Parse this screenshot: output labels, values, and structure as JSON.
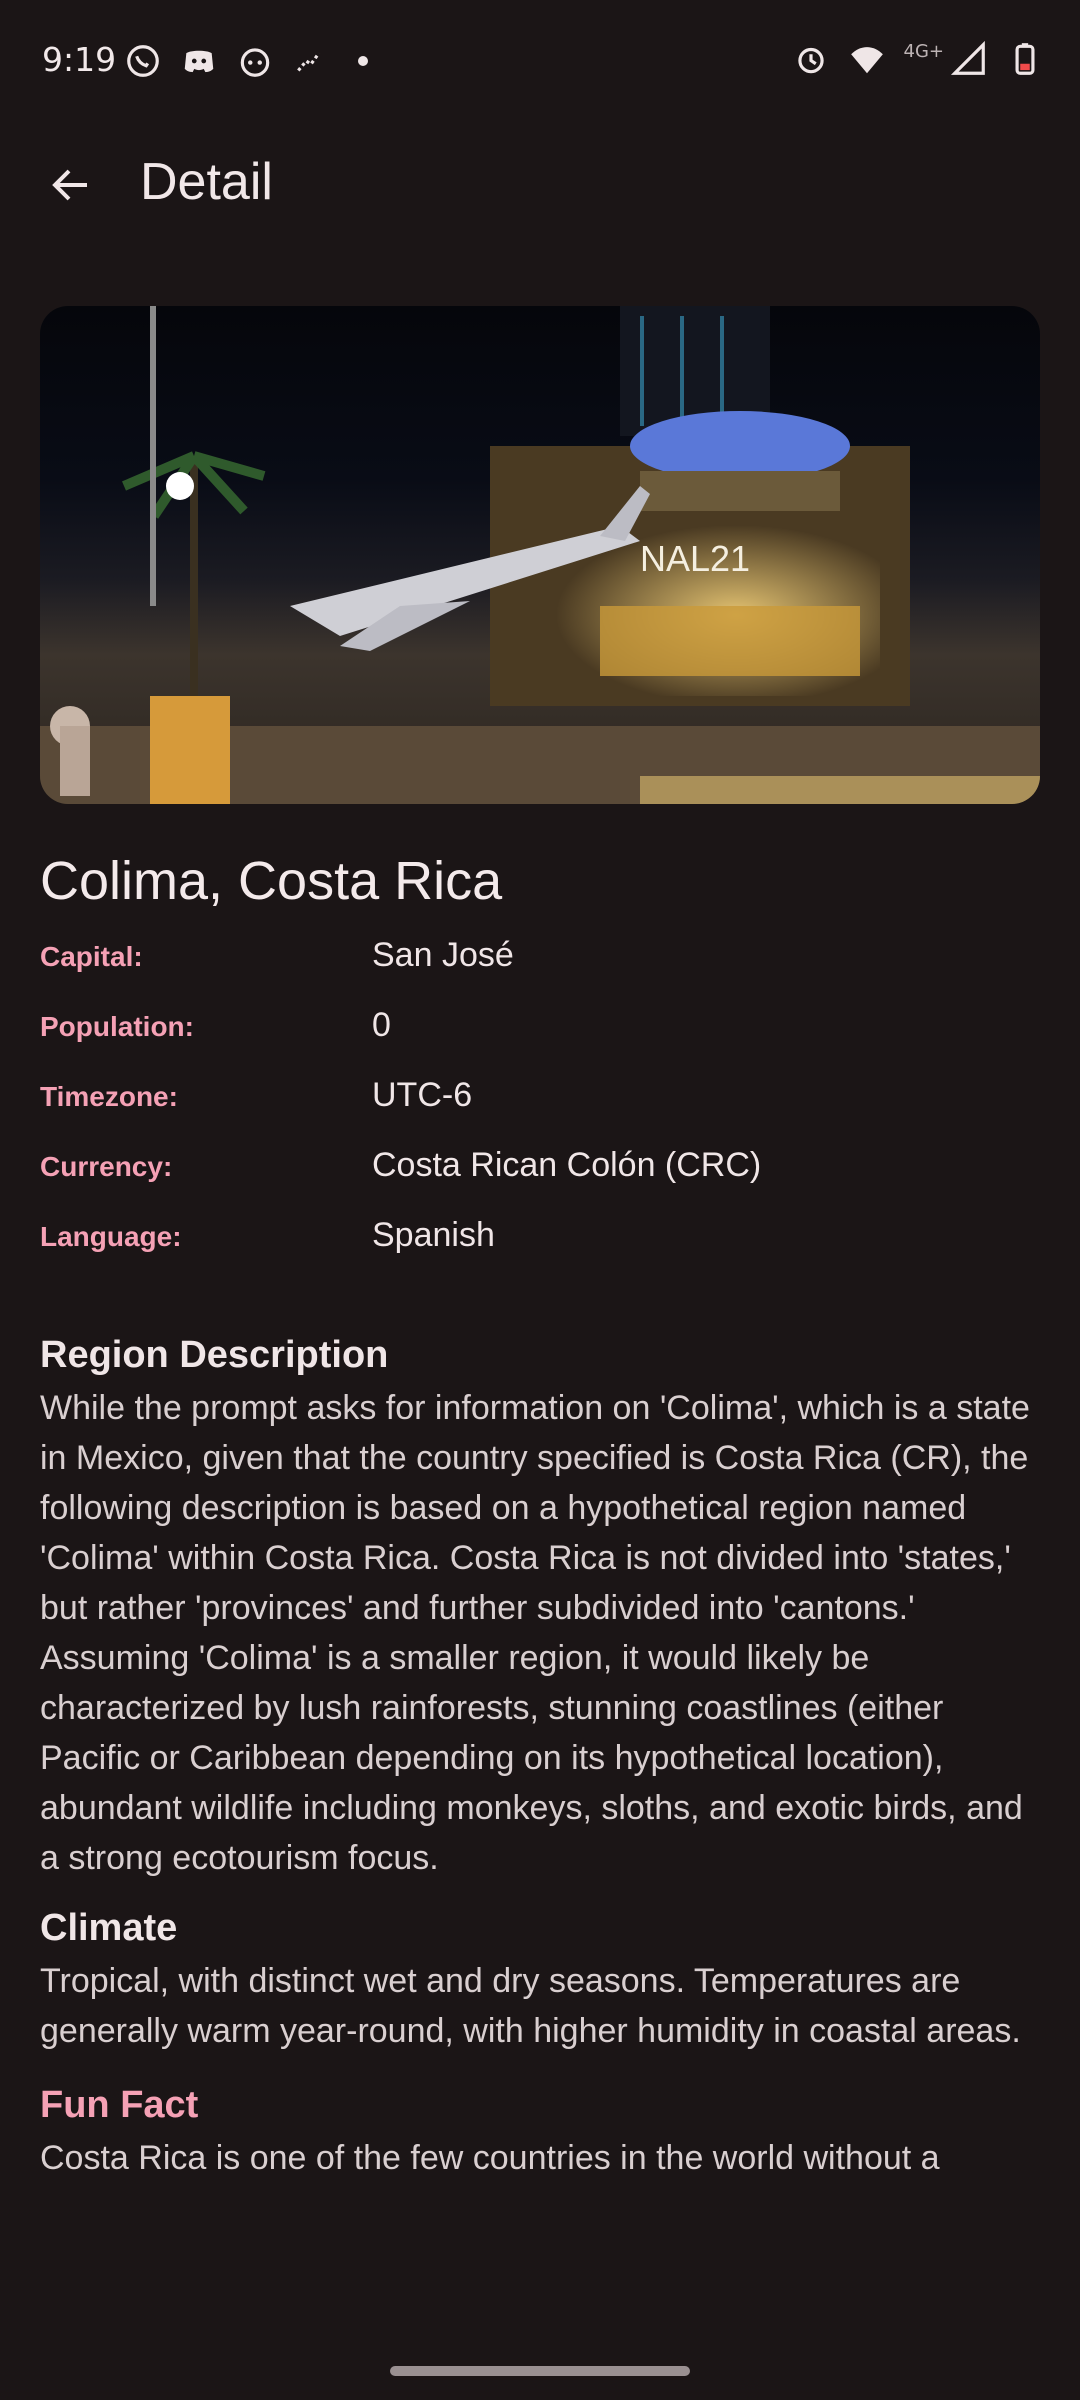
{
  "status": {
    "time": "9:19",
    "network": "4G+",
    "left_icons": [
      "whatsapp-icon",
      "discord-icon",
      "reddit-icon",
      "fitness-icon"
    ],
    "right_icons": [
      "alarm-icon",
      "wifi-icon",
      "signal-icon",
      "battery-icon"
    ]
  },
  "appbar": {
    "title": "Detail"
  },
  "place": {
    "name": "Colima, Costa Rica",
    "fields": [
      {
        "label": "Capital:",
        "value": "San José"
      },
      {
        "label": "Population:",
        "value": "0"
      },
      {
        "label": "Timezone:",
        "value": "UTC-6"
      },
      {
        "label": "Currency:",
        "value": "Costa Rican Colón (CRC)"
      },
      {
        "label": "Language:",
        "value": "Spanish"
      }
    ]
  },
  "sections": {
    "region_title": "Region Description",
    "region_text": "While the prompt asks for information on 'Colima', which is a state in Mexico, given that the country specified is Costa Rica (CR), the following description is based on a hypothetical region named 'Colima' within Costa Rica. Costa Rica is not divided into 'states,' but rather 'provinces' and further subdivided into 'cantons.' Assuming 'Colima' is a smaller region, it would likely be characterized by lush rainforests, stunning coastlines (either Pacific or Caribbean depending on its hypothetical location), abundant wildlife including monkeys, sloths, and exotic birds, and a strong ecotourism focus.",
    "climate_title": "Climate",
    "climate_text": "Tropical, with distinct wet and dry seasons. Temperatures are generally warm year-round, with higher humidity in coastal areas.",
    "fun_title": "Fun Fact",
    "fun_text": "Costa Rica is one of the few countries in the world without a"
  },
  "image": {
    "sign_text": "NAL21"
  },
  "colors": {
    "accent": "#f5a1b5",
    "background": "#1b1516"
  }
}
